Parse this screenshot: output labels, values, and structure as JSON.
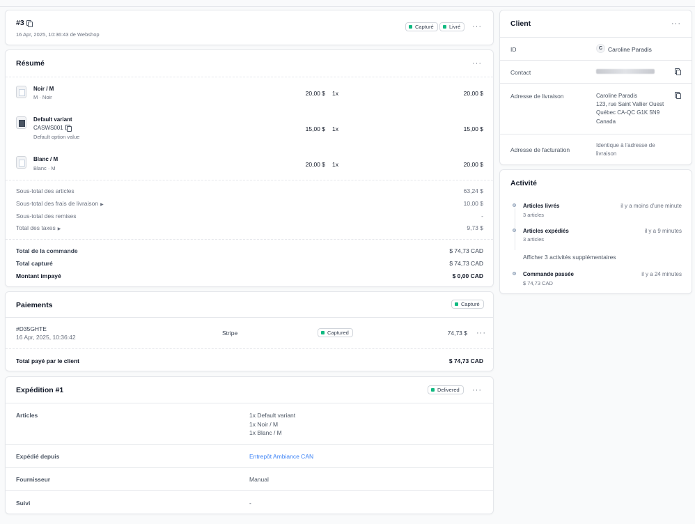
{
  "order": {
    "number": "#3",
    "meta": "16 Apr, 2025, 10:36:43 de Webshop",
    "badges": [
      "Capturé",
      "Livré"
    ]
  },
  "summary": {
    "title": "Résumé",
    "items": [
      {
        "name": "Noir / M",
        "sub": "M · Noir",
        "price": "20,00 $",
        "qty": "1x",
        "total": "20,00 $"
      },
      {
        "name": "Default variant",
        "sku": "CASWS001",
        "sub": "Default option value",
        "price": "15,00 $",
        "qty": "1x",
        "total": "15,00 $"
      },
      {
        "name": "Blanc / M",
        "sub": "Blanc · M",
        "price": "20,00 $",
        "qty": "1x",
        "total": "20,00 $"
      }
    ],
    "subtotals": [
      {
        "label": "Sous-total des articles",
        "value": "63,24 $"
      },
      {
        "label": "Sous-total des frais de livraison",
        "value": "10,00 $"
      },
      {
        "label": "Sous-total des remises",
        "value": "-"
      },
      {
        "label": "Total des taxes",
        "value": "9,73 $"
      }
    ],
    "totals": [
      {
        "label": "Total de la commande",
        "value": "$ 74,73 CAD"
      },
      {
        "label": "Total capturé",
        "value": "$ 74,73 CAD"
      },
      {
        "label": "Montant impayé",
        "value": "$ 0,00 CAD"
      }
    ]
  },
  "payments": {
    "title": "Paiements",
    "badge": "Capturé",
    "id": "#D35GHTE",
    "date": "16 Apr, 2025, 10:36:42",
    "provider": "Stripe",
    "status": "Captured",
    "amount": "74,73 $",
    "total_label": "Total payé par le client",
    "total_value": "$ 74,73 CAD"
  },
  "shipment": {
    "title": "Expédition #1",
    "badge": "Delivered",
    "rows": {
      "articles_label": "Articles",
      "articles": [
        "1x Default variant",
        "1x Noir / M",
        "1x Blanc / M"
      ],
      "from_label": "Expédié depuis",
      "from_value": "Entrepôt Ambiance CAN",
      "provider_label": "Fournisseur",
      "provider_value": "Manual",
      "tracking_label": "Suivi",
      "tracking_value": "-"
    }
  },
  "client": {
    "title": "Client",
    "id_label": "ID",
    "avatar_letter": "C",
    "name": "Caroline Paradis",
    "contact_label": "Contact",
    "shipping_label": "Adresse de livraison",
    "shipping_lines": [
      "Caroline Paradis",
      "123, rue Saint Vallier Ouest",
      "Québec CA-QC G1K 5N9",
      "Canada"
    ],
    "billing_label": "Adresse de facturation",
    "billing_lines": [
      "Identique à l'adresse de",
      "livraison"
    ]
  },
  "activity": {
    "title": "Activité",
    "events": [
      {
        "title": "Articles livrés",
        "sub": "3 articles",
        "time": "il y a moins d'une minute"
      },
      {
        "title": "Articles expédiés",
        "sub": "3 articles",
        "time": "il y a 9 minutes"
      }
    ],
    "more": "Afficher 3 activités supplémentaires",
    "last": {
      "title": "Commande passée",
      "sub": "$ 74,73 CAD",
      "time": "il y a 24 minutes"
    }
  }
}
